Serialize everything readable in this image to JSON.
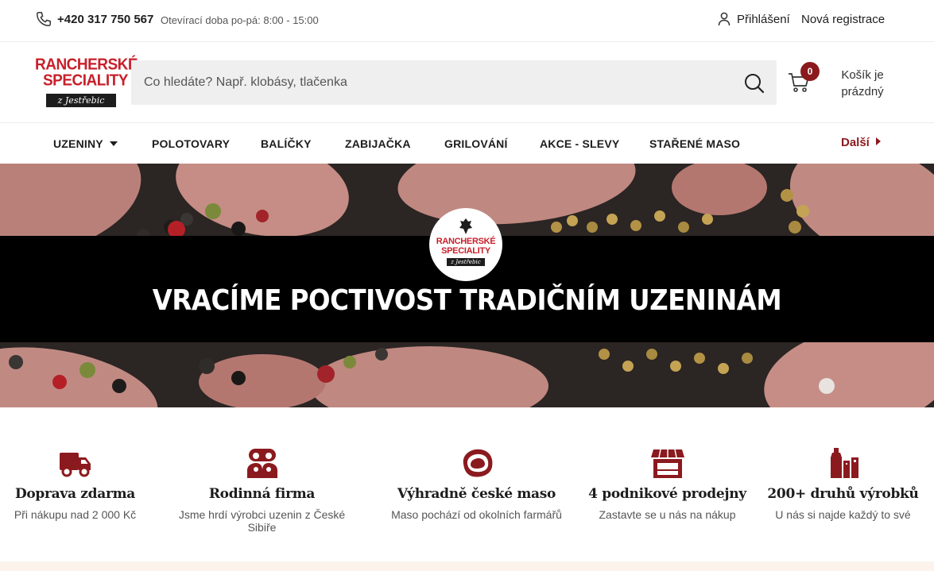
{
  "topbar": {
    "phone": "+420 317 750 567",
    "opening_hours": "Otevírací doba po-pá: 8:00 - 15:00",
    "login": "Přihlášení",
    "register": "Nová registrace"
  },
  "header": {
    "logo_line1": "RANCHERSKÉ",
    "logo_line2": "SPECIALITY",
    "logo_ribbon": "z Jestřebic",
    "search_placeholder": "Co hledáte? Např. klobásy, tlačenka",
    "cart_count": "0",
    "cart_text": "Košík je prázdný"
  },
  "nav": {
    "items": [
      {
        "label": "UZENINY"
      },
      {
        "label": "POLOTOVARY"
      },
      {
        "label": "BALÍČKY"
      },
      {
        "label": "ZABIJAČKA"
      },
      {
        "label": "GRILOVÁNÍ"
      },
      {
        "label": "AKCE - SLEVY"
      },
      {
        "label": "STAŘENÉ MASO"
      }
    ],
    "more": "Další"
  },
  "hero": {
    "title": "VRACÍME POCTIVOST TRADIČNÍM UZENINÁM",
    "logo_line1": "RANCHERSKÉ",
    "logo_line2": "SPECIALITY",
    "logo_ribbon": "z Jestřebic"
  },
  "features": [
    {
      "icon": "truck-icon",
      "title": "Doprava zdarma",
      "subtitle": "Při nákupu nad 2 000 Kč"
    },
    {
      "icon": "family-icon",
      "title": "Rodinná firma",
      "subtitle": "Jsme hrdí výrobci uzenin z České Sibiře"
    },
    {
      "icon": "meat-icon",
      "title": "Výhradně české maso",
      "subtitle": "Maso pochází od okolních farmářů"
    },
    {
      "icon": "store-icon",
      "title": "4 podnikové prodejny",
      "subtitle": "Zastavte se u nás na nákup"
    },
    {
      "icon": "products-icon",
      "title": "200+ druhů výrobků",
      "subtitle": "U nás si najde každý to své"
    }
  ],
  "colors": {
    "brand_red": "#c8202b",
    "accent_dark_red": "#8b1a1f",
    "hero_band": "#000000"
  }
}
